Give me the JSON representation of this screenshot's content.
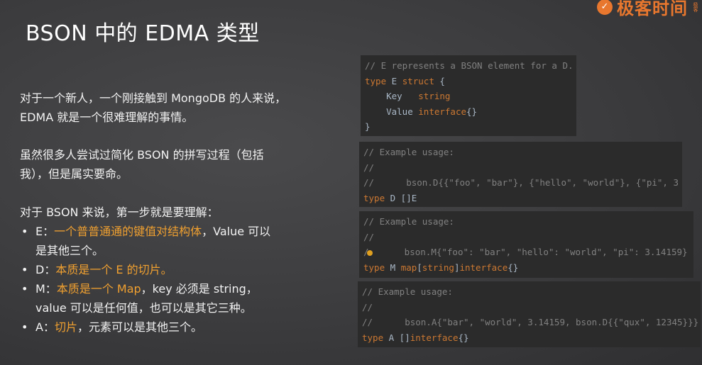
{
  "logo": {
    "badge": "✓",
    "text": "极客时间",
    "small": "极客"
  },
  "title": "BSON 中的 EDMA 类型",
  "paragraphs": {
    "p1_line1": "对于一个新人，一个刚接触到 MongoDB 的人来说，",
    "p1_line2": "EDMA 就是一个很难理解的事情。",
    "p2_line1": "虽然很多人尝试过简化 BSON 的拼写过程（包括",
    "p2_line2": "我），但是属实要命。",
    "p3": "对于 BSON 来说，第一步就是要理解："
  },
  "bullets": [
    {
      "prefix": "E：",
      "highlight": "一个普普通通的键值对结构体",
      "rest_line1": "，Value 可以",
      "rest_line2": "是其他三个。"
    },
    {
      "prefix": "D：",
      "highlight": "本质是一个 E  的切片。",
      "rest_line1": "",
      "rest_line2": ""
    },
    {
      "prefix": "M：",
      "highlight": "本质是一个 Map",
      "rest_line1": "，key 必须是 string，",
      "rest_line2": "value 可以是任何值，也可以是其它三种。"
    },
    {
      "prefix": "A：",
      "highlight": "切片",
      "rest_line1": "，元素可以是其他三个。",
      "rest_line2": ""
    }
  ],
  "code_blocks": {
    "e": {
      "comment": "// E represents a BSON element for a D.",
      "kw_type": "type",
      "name": " E ",
      "kw_struct": "struct",
      "brace_open": " {",
      "field1_name": "    Key   ",
      "field1_type": "string",
      "field2_name": "    Value ",
      "field2_type": "interface",
      "field2_suffix": "{}",
      "brace_close": "}"
    },
    "d": {
      "l1": "// Example usage:",
      "l2": "//",
      "l3": "//      bson.D{{\"foo\", \"bar\"}, {\"hello\", \"world\"}, {\"pi\", 3",
      "kw_type": "type",
      "rest": " D []E"
    },
    "m": {
      "l1": "// Example usage:",
      "l2": "//",
      "l3_prefix": "/",
      "l3": "      bson.M{\"foo\": \"bar\", \"hello\": \"world\", \"pi\": 3.14159}",
      "kw_type": "type",
      "name": " M ",
      "kw_map": "map",
      "bracket_open": "[",
      "key_type": "string",
      "bracket_close": "]",
      "value_type": "interface",
      "suffix": "{}"
    },
    "a": {
      "l1": "// Example usage:",
      "l2": "//",
      "l3": "//      bson.A{\"bar\", \"world\", 3.14159, bson.D{{\"qux\", 12345}}}",
      "kw_type": "type",
      "name": " A []",
      "value_type": "interface",
      "suffix": "{}"
    }
  }
}
